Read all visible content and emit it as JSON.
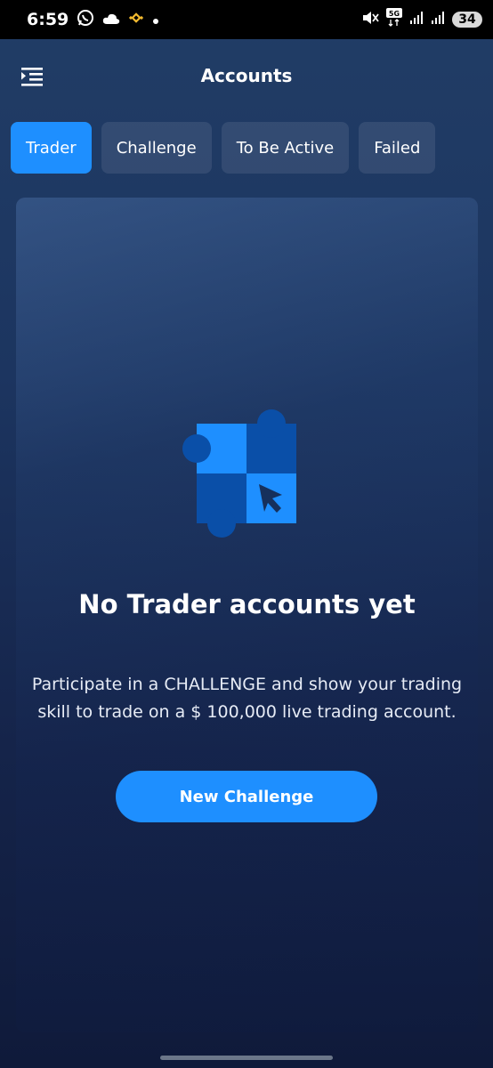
{
  "status_bar": {
    "time": "6:59",
    "battery": "34",
    "network": "5G",
    "icons": [
      "whatsapp-icon",
      "cloud-icon",
      "binance-icon",
      "dot-icon",
      "mute-icon",
      "signal-icon",
      "signal-icon"
    ]
  },
  "header": {
    "title": "Accounts",
    "menu_icon": "menu-icon"
  },
  "tabs": [
    {
      "label": "Trader",
      "active": true
    },
    {
      "label": "Challenge",
      "active": false
    },
    {
      "label": "To Be Active",
      "active": false
    },
    {
      "label": "Failed",
      "active": false
    }
  ],
  "empty_state": {
    "illustration": "puzzle-cursor-icon",
    "title": "No Trader accounts yet",
    "description": "Participate in a CHALLENGE and show your trading skill to trade on a $ 100,000 live trading account.",
    "button_label": "New Challenge"
  },
  "colors": {
    "accent": "#1e8fff",
    "dark_blue": "#0a4fa8",
    "binance": "#f3ba2f"
  }
}
